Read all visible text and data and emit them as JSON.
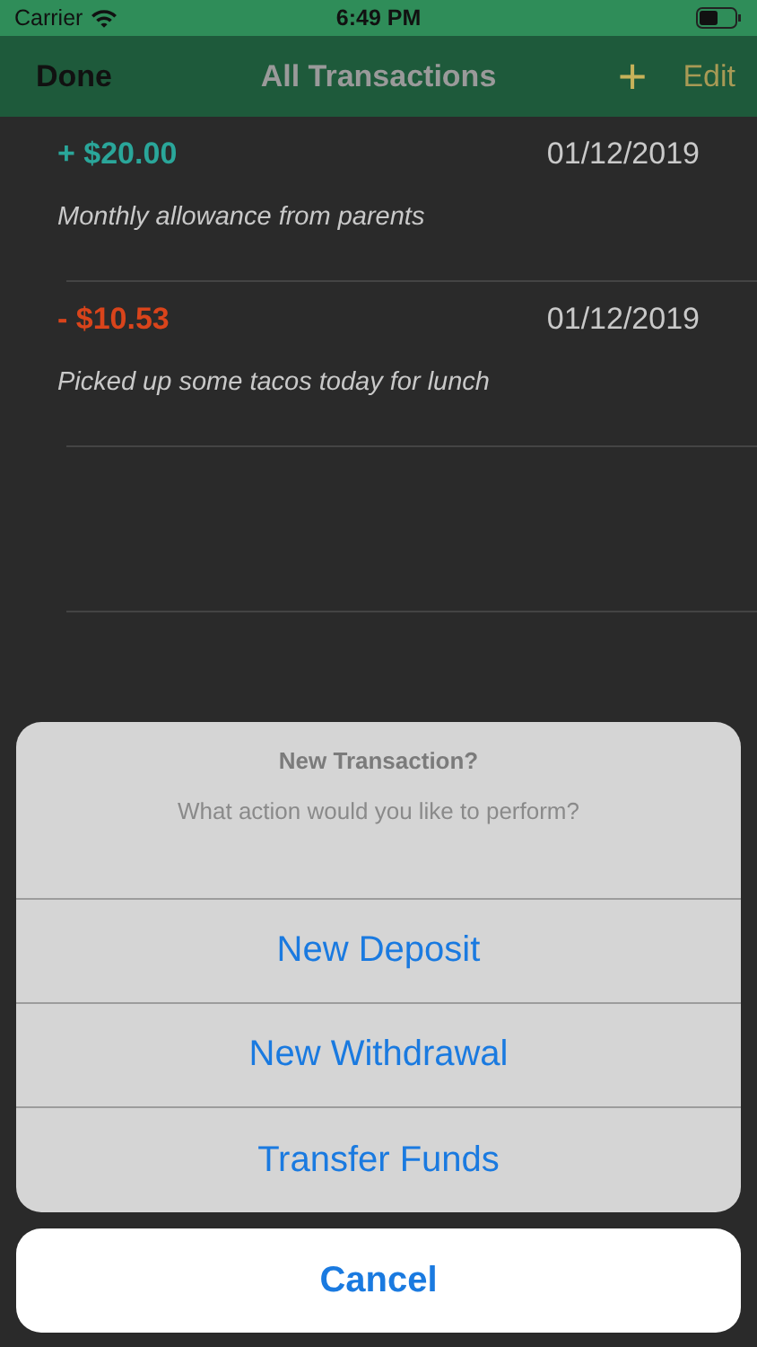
{
  "status_bar": {
    "carrier": "Carrier",
    "time": "6:49 PM"
  },
  "nav_bar": {
    "left": "Done",
    "title": "All Transactions",
    "add": "+",
    "right": "Edit"
  },
  "transactions": [
    {
      "kind": "deposit",
      "amount": "+ $20.00",
      "date": "01/12/2019",
      "description": "Monthly allowance from parents"
    },
    {
      "kind": "withdrawal",
      "amount": "- $10.53",
      "date": "01/12/2019",
      "description": "Picked up some tacos today for lunch"
    }
  ],
  "action_sheet": {
    "title": "New Transaction?",
    "message": "What action would you like to perform?",
    "actions": [
      "New Deposit",
      "New Withdrawal",
      "Transfer Funds"
    ],
    "cancel": "Cancel"
  }
}
